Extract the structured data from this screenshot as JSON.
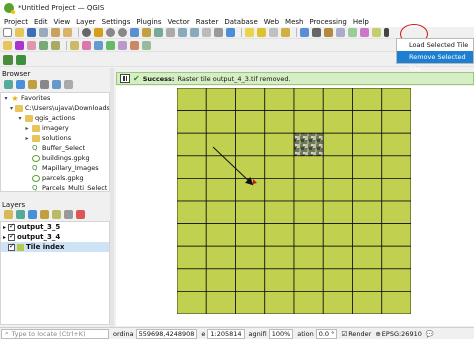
{
  "window": {
    "title": "*Untitled Project — QGIS"
  },
  "menu": [
    "Project",
    "Edit",
    "View",
    "Layer",
    "Settings",
    "Plugins",
    "Vector",
    "Raster",
    "Database",
    "Web",
    "Mesh",
    "Processing",
    "Help"
  ],
  "dropdown": {
    "items": [
      "Load Selected Tile",
      "Remove Selected Tile"
    ],
    "selected_index": 1
  },
  "browser": {
    "title": "Browser",
    "items": [
      {
        "label": "Favorites",
        "depth": 0,
        "icon": "star-icon",
        "expanded": true
      },
      {
        "label": "C:\\Users\\ujava\\Downloads",
        "depth": 1,
        "icon": "folder-icon",
        "expanded": true
      },
      {
        "label": "qgis_actions",
        "depth": 2,
        "icon": "folder-icon",
        "expanded": true
      },
      {
        "label": "imagery",
        "depth": 3,
        "icon": "folder-icon"
      },
      {
        "label": "solutions",
        "depth": 3,
        "icon": "folder-icon"
      },
      {
        "label": "Buffer_Select",
        "depth": 3,
        "icon": "project-icon"
      },
      {
        "label": "buildings.gpkg",
        "depth": 3,
        "icon": "geopackage-icon"
      },
      {
        "label": "Mapillary_Images",
        "depth": 3,
        "icon": "project-icon"
      },
      {
        "label": "parcels.gpkg",
        "depth": 3,
        "icon": "geopackage-icon"
      },
      {
        "label": "Parcels_Multi_Select",
        "depth": 3,
        "icon": "project-icon"
      }
    ]
  },
  "layers": {
    "title": "Layers",
    "items": [
      {
        "label": "output_3_5",
        "checked": true,
        "type": "raster"
      },
      {
        "label": "output_3_4",
        "checked": true,
        "type": "raster"
      },
      {
        "label": "Tile index",
        "checked": true,
        "type": "polygon",
        "color": "#b5c94a"
      }
    ]
  },
  "message": {
    "label": "Success:",
    "text": "Raster tile output_4_3.tif removed."
  },
  "status": {
    "locator_placeholder": "Type to locate (Ctrl+K)",
    "coordinate_label": "ordina",
    "coordinate": "559698,4248908",
    "scale_label": "e",
    "scale": "1:205814",
    "magnifier_label": "agnifi",
    "magnifier": "100%",
    "rotation_label": "ation",
    "rotation": "0.0 °",
    "render_label": "Render",
    "crs": "EPSG:26910"
  },
  "colors": {
    "tile_fill": "#c2d04f",
    "highlight_circle": "#d01515",
    "selection": "#1d7fd1"
  },
  "map": {
    "grid_cols": 8,
    "grid_rows": 10,
    "imagery_tile": {
      "col": 4,
      "row": 2
    }
  }
}
